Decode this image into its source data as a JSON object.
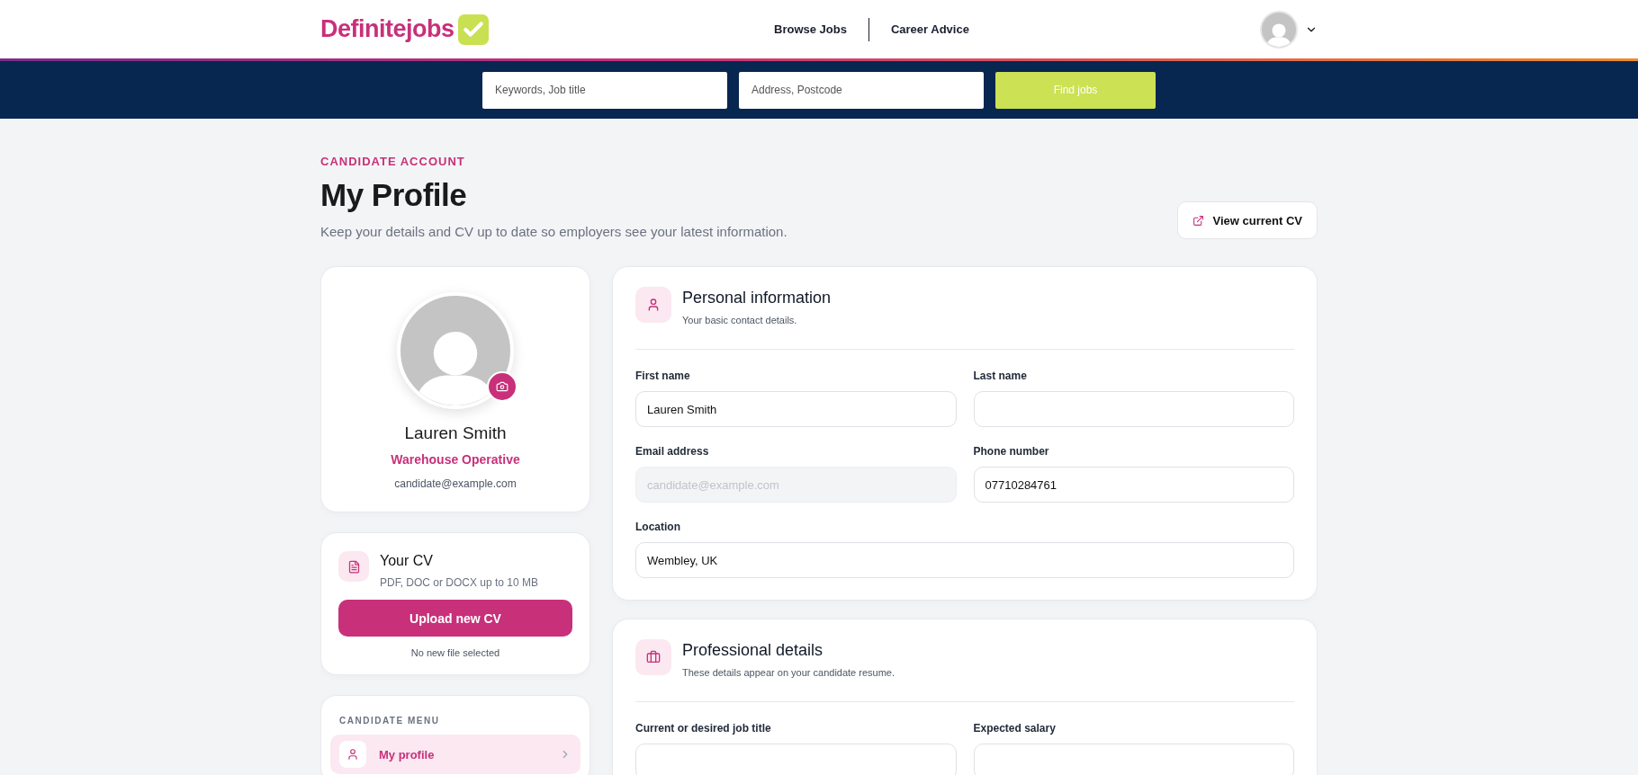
{
  "header": {
    "logo": "Definitejobs",
    "nav": [
      {
        "label": "Browse Jobs"
      },
      {
        "label": "Career Advice"
      }
    ]
  },
  "search": {
    "keyword_placeholder": "Keywords, Job title",
    "location_placeholder": "Address, Postcode",
    "button": "Find jobs"
  },
  "page": {
    "eyebrow": "CANDIDATE ACCOUNT",
    "title": "My Profile",
    "subtitle": "Keep your details and CV up to date so employers see your latest information.",
    "view_cv_button": "View current CV"
  },
  "profile_card": {
    "name": "Lauren Smith",
    "job_title": "Warehouse Operative",
    "email": "candidate@example.com"
  },
  "cv_card": {
    "title": "Your CV",
    "hint": "PDF, DOC or DOCX up to 10 MB",
    "button": "Upload new CV",
    "status": "No new file selected"
  },
  "menu": {
    "heading": "CANDIDATE MENU",
    "items": [
      {
        "label": "My profile",
        "selected": true
      }
    ]
  },
  "sections": [
    {
      "kind": "person",
      "title": "Personal information",
      "subtitle": "Your basic contact details.",
      "fields": [
        {
          "label": "First name",
          "value": "Lauren Smith",
          "disabled": false,
          "wide": false
        },
        {
          "label": "Last name",
          "disabled": false,
          "wide": false
        },
        {
          "label": "Email address",
          "value": "candidate@example.com",
          "disabled": true,
          "wide": false
        },
        {
          "label": "Phone number",
          "value": "07710284761",
          "disabled": false,
          "wide": false
        },
        {
          "label": "Location",
          "value": "Wembley, UK",
          "disabled": false,
          "wide": true
        }
      ]
    },
    {
      "kind": "briefcase",
      "title": "Professional details",
      "subtitle": "These details appear on your candidate resume.",
      "fields": [
        {
          "label": "Current or desired job title",
          "disabled": false,
          "wide": false
        },
        {
          "label": "Expected salary",
          "disabled": false,
          "wide": false
        }
      ]
    }
  ]
}
